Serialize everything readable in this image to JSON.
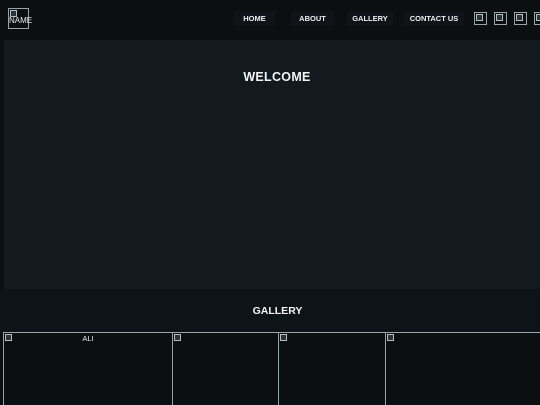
{
  "header": {
    "logo_alt": "NAME",
    "nav": [
      {
        "label": "HOME"
      },
      {
        "label": "ABOUT"
      },
      {
        "label": "GALLERY"
      },
      {
        "label": "CONTACT US"
      }
    ],
    "social_icons": [
      "social-icon-1",
      "social-icon-2",
      "social-icon-3",
      "social-icon-4"
    ]
  },
  "hero": {
    "title": "WELCOME"
  },
  "gallery": {
    "title": "GALLERY",
    "items": [
      {
        "alt": "ALI"
      },
      {
        "alt": ""
      },
      {
        "alt": ""
      },
      {
        "alt": ""
      }
    ]
  },
  "colors": {
    "page_bg": "#0b0f12",
    "hero_bg": "#131a1f",
    "nav_button_bg": "#101418",
    "text": "#f2f4f5"
  }
}
